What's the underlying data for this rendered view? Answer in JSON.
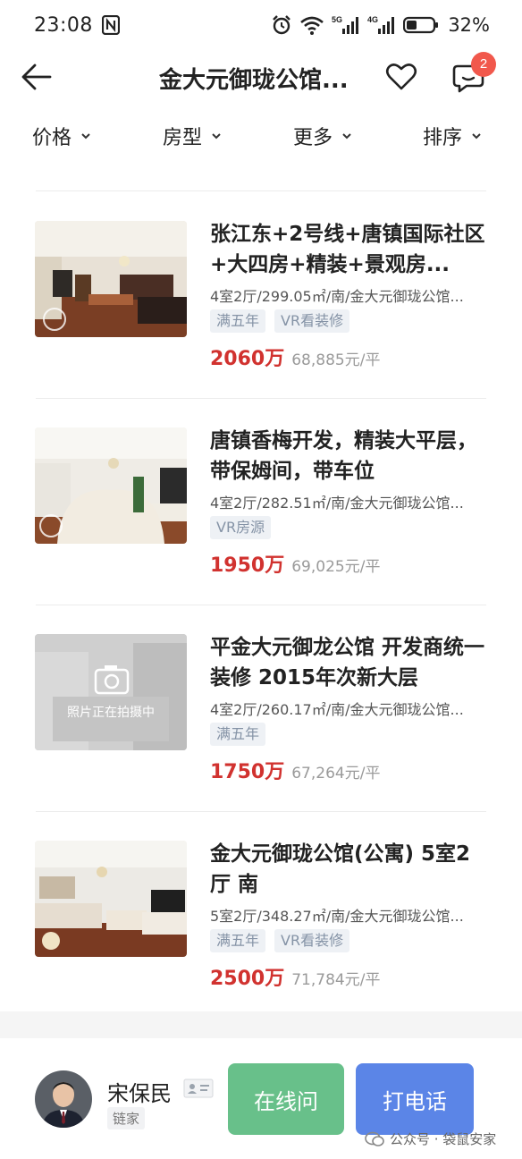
{
  "status_bar": {
    "time": "23:08",
    "battery": "32%",
    "network_1": "5G",
    "network_2": "4G"
  },
  "nav": {
    "title": "金大元御珑公馆...",
    "message_badge": "2"
  },
  "filters": [
    {
      "label": "价格"
    },
    {
      "label": "房型"
    },
    {
      "label": "更多"
    },
    {
      "label": "排序"
    }
  ],
  "listings": [
    {
      "title": "张江东+2号线+唐镇国际社区+大四房+精装+景观房...",
      "meta": "4室2厅/299.05㎡/南/金大元御珑公馆...",
      "tags": [
        "满五年",
        "VR看装修"
      ],
      "price": "2060万",
      "unit_price": "68,885元/平"
    },
    {
      "title": "唐镇香梅开发，精装大平层，带保姆间，带车位",
      "meta": "4室2厅/282.51㎡/南/金大元御珑公馆...",
      "tags": [
        "VR房源"
      ],
      "price": "1950万",
      "unit_price": "69,025元/平"
    },
    {
      "title": "平金大元御龙公馆 开发商统一装修 2015年次新大层",
      "meta": "4室2厅/260.17㎡/南/金大元御珑公馆...",
      "tags": [
        "满五年"
      ],
      "price": "1750万",
      "unit_price": "67,264元/平",
      "photo_placeholder": "照片正在拍摄中"
    },
    {
      "title": "金大元御珑公馆(公寓) 5室2厅 南",
      "meta": "5室2厅/348.27㎡/南/金大元御珑公馆...",
      "tags": [
        "满五年",
        "VR看装修"
      ],
      "price": "2500万",
      "unit_price": "71,784元/平"
    }
  ],
  "agent": {
    "name": "宋保民",
    "company": "链家",
    "online_button": "在线问",
    "call_button": "打电话"
  },
  "watermark": "公众号 · 袋鼠安家",
  "colors": {
    "price_red": "#d1322f",
    "online_green": "#68c08a",
    "call_blue": "#5b85e7",
    "badge_red": "#f1584c",
    "tag_bg": "#eef1f5",
    "tag_text": "#8593a6"
  }
}
